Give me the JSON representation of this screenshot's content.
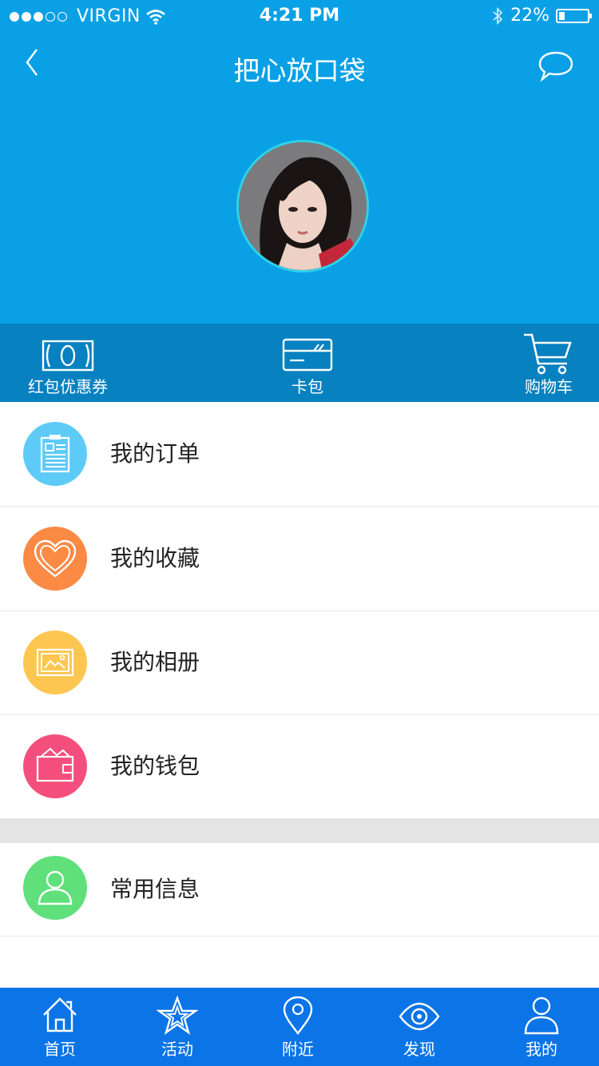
{
  "status_bar": {
    "carrier": "VIRGIN",
    "time": "4:21 PM",
    "battery": "22%",
    "battery_level": 0.22
  },
  "header": {
    "title": "把心放口袋",
    "back_icon": "chevron-left-icon",
    "message_icon": "chat-bubble-icon",
    "bg_color": "#0aa0e6"
  },
  "quick_actions": [
    {
      "label": "红包优惠券",
      "icon": "coupon-icon"
    },
    {
      "label": "卡包",
      "icon": "card-icon"
    },
    {
      "label": "购物车",
      "icon": "cart-icon"
    }
  ],
  "menu": {
    "items": [
      {
        "label": "我的订单",
        "icon": "order-icon",
        "color": "#5ecbf7"
      },
      {
        "label": "我的收藏",
        "icon": "heart-icon",
        "color": "#fb8a45"
      },
      {
        "label": "我的相册",
        "icon": "album-icon",
        "color": "#fdc651"
      },
      {
        "label": "我的钱包",
        "icon": "wallet-icon",
        "color": "#f44f7c"
      },
      {
        "label": "常用信息",
        "icon": "user-icon",
        "color": "#5fe07b"
      }
    ]
  },
  "tab_bar": {
    "tabs": [
      {
        "label": "首页",
        "icon": "home-icon"
      },
      {
        "label": "活动",
        "icon": "star-icon"
      },
      {
        "label": "附近",
        "icon": "location-pin-icon"
      },
      {
        "label": "发现",
        "icon": "eye-icon"
      },
      {
        "label": "我的",
        "icon": "user-icon"
      }
    ],
    "bg_color": "#0b74e6"
  }
}
